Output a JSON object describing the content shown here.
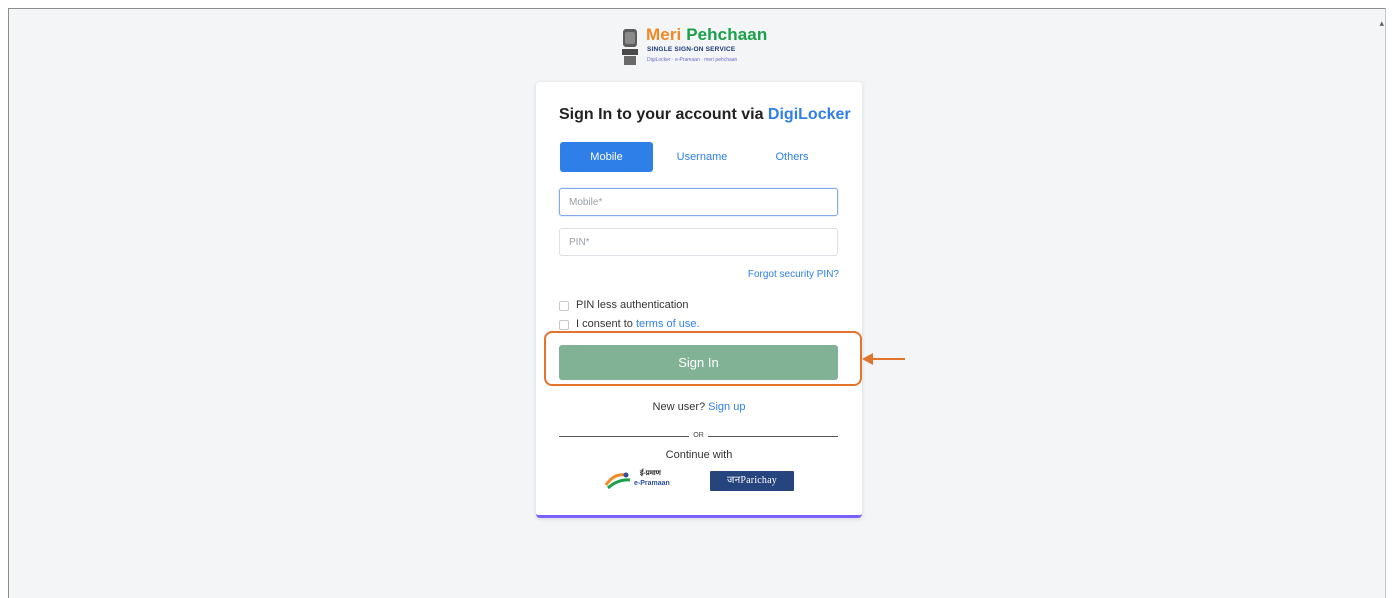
{
  "logo": {
    "title_part1": "Meri ",
    "title_part2": "Pehchaan",
    "subtitle": "SINGLE SIGN-ON SERVICE",
    "partners": "DigiLocker · e-Pramaan · meri pehchaan"
  },
  "card": {
    "title_prefix": "Sign In to your account via ",
    "title_brand": "DigiLocker"
  },
  "tabs": [
    {
      "label": "Mobile",
      "active": true
    },
    {
      "label": "Username",
      "active": false
    },
    {
      "label": "Others",
      "active": false
    }
  ],
  "form": {
    "mobile_placeholder": "Mobile*",
    "pin_placeholder": "PIN*",
    "forgot_label": "Forgot security PIN?",
    "pinless_label": "PIN less authentication",
    "consent_prefix": "I consent to ",
    "consent_link": "terms of use.",
    "signin_label": "Sign In"
  },
  "signup": {
    "prefix": "New user? ",
    "link": "Sign up"
  },
  "divider_label": "OR",
  "continue_label": "Continue with",
  "providers": {
    "epramaan_hindi": "ई-प्रमाण",
    "epramaan": "e-Pramaan",
    "janparichay": "जनParichay"
  },
  "colors": {
    "accent": "#2f7fe8",
    "signin_button": "#82b295",
    "highlight": "#e2742c",
    "card_bottom_border": "#7b61ff"
  }
}
